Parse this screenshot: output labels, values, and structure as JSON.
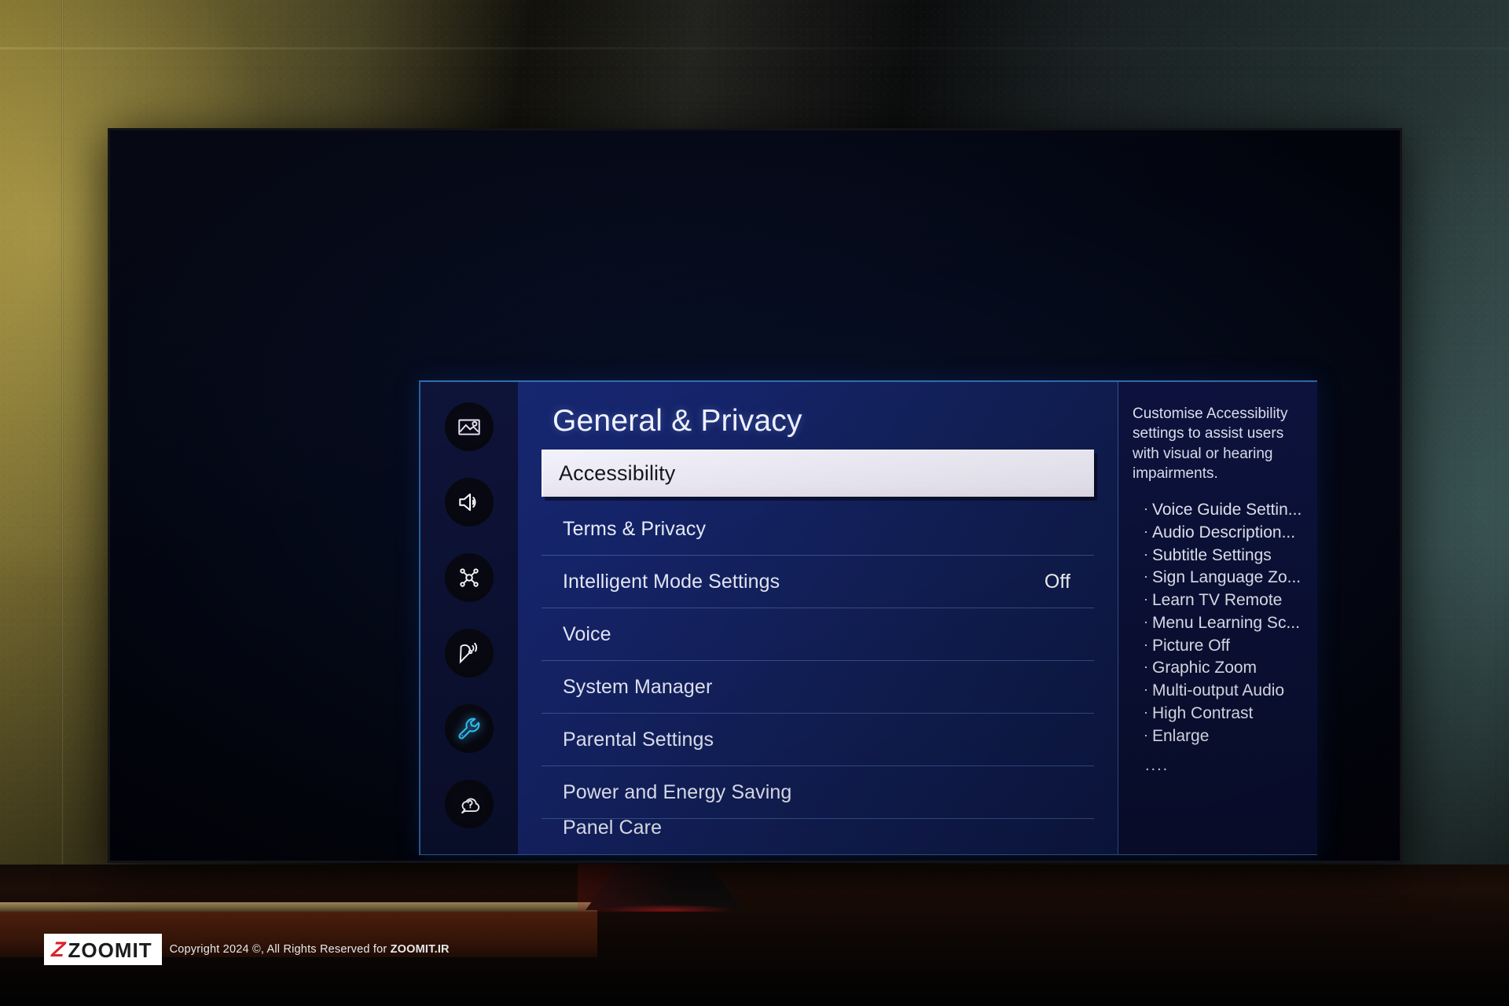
{
  "scene": {
    "device": "television",
    "watermark": {
      "logo_mark": "Z",
      "logo_name": "ZOOMIT",
      "copyright": "Copyright 2024 ©, All Rights Reserved for ",
      "copyright_site": "ZOOMIT.IR"
    }
  },
  "osd": {
    "title": "General & Privacy",
    "rail": [
      {
        "name": "picture-icon",
        "label": "Picture"
      },
      {
        "name": "sound-icon",
        "label": "Sound"
      },
      {
        "name": "connection-icon",
        "label": "Connection"
      },
      {
        "name": "broadcast-icon",
        "label": "Broadcast"
      },
      {
        "name": "general-privacy-icon",
        "label": "General & Privacy",
        "active": true
      },
      {
        "name": "support-icon",
        "label": "Support"
      }
    ],
    "rows": [
      {
        "label": "Accessibility",
        "value": "",
        "selected": true,
        "clipped": false
      },
      {
        "label": "Terms & Privacy",
        "value": "",
        "selected": false,
        "clipped": false
      },
      {
        "label": "Intelligent Mode Settings",
        "value": "Off",
        "selected": false,
        "clipped": false
      },
      {
        "label": "Voice",
        "value": "",
        "selected": false,
        "clipped": false
      },
      {
        "label": "System Manager",
        "value": "",
        "selected": false,
        "clipped": false
      },
      {
        "label": "Parental Settings",
        "value": "",
        "selected": false,
        "clipped": false
      },
      {
        "label": "Power and Energy Saving",
        "value": "",
        "selected": false,
        "clipped": false
      },
      {
        "label": "Panel Care",
        "value": "",
        "selected": false,
        "clipped": true
      }
    ],
    "description": {
      "text": "Customise Accessibility settings to assist users with visual or hearing impairments.",
      "items": [
        "Voice Guide Settin...",
        "Audio Description...",
        "Subtitle Settings",
        "Sign Language Zo...",
        "Learn TV Remote",
        "Menu Learning Sc...",
        "Picture Off",
        "Graphic Zoom",
        "Multi-output Audio",
        "High Contrast",
        "Enlarge"
      ],
      "more": "...."
    }
  },
  "colors": {
    "menu_blue": "#16266f",
    "rail_blue": "#0e1338",
    "desc_blue": "#0d1340",
    "highlight_bg": "#f4f2fb",
    "highlight_text": "#17171c",
    "accent_cyan": "#3cc8ff",
    "border_blue": "#2e6fb0",
    "watermark_red": "#d8232a"
  }
}
